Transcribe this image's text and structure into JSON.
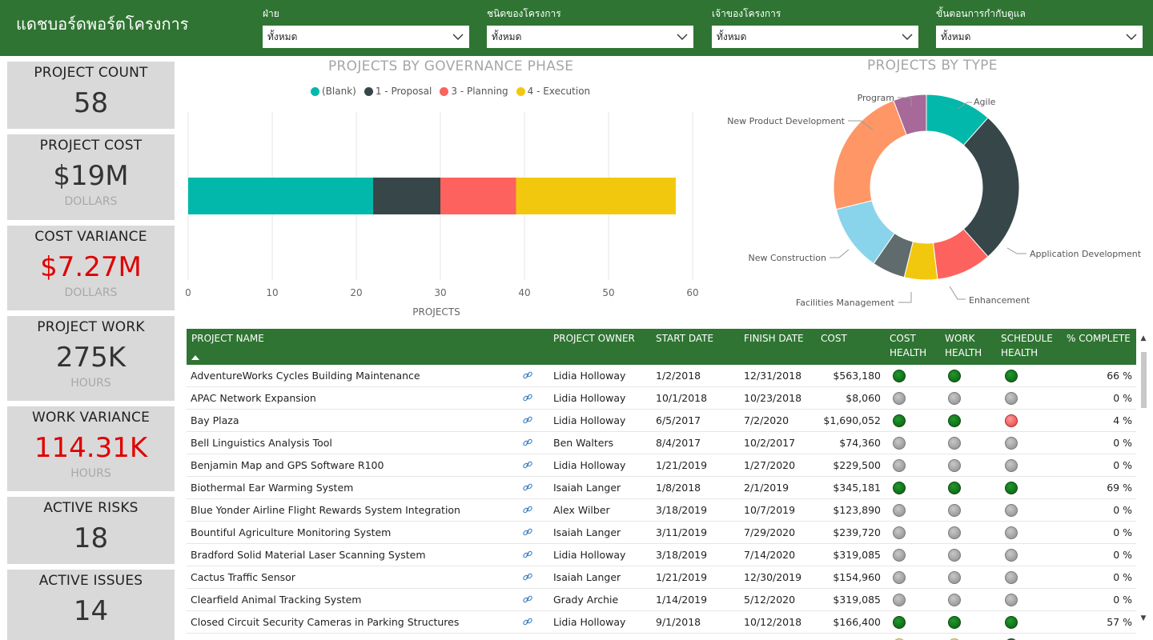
{
  "header": {
    "title": "แดชบอร์ดพอร์ตโครงการ",
    "filters": [
      {
        "label": "ฝ่าย",
        "value": "ทั้งหมด"
      },
      {
        "label": "ชนิดของโครงการ",
        "value": "ทั้งหมด"
      },
      {
        "label": "เจ้าของโครงการ",
        "value": "ทั้งหมด"
      },
      {
        "label": "ขั้นตอนการกำกับดูแล",
        "value": "ทั้งหมด"
      }
    ]
  },
  "cards": [
    {
      "title": "PROJECT COUNT",
      "value": "58",
      "unit": ""
    },
    {
      "title": "PROJECT COST",
      "value": "$19M",
      "unit": "DOLLARS"
    },
    {
      "title": "COST VARIANCE",
      "value": "$7.27M",
      "unit": "DOLLARS"
    },
    {
      "title": "PROJECT WORK",
      "value": "275K",
      "unit": "HOURS"
    },
    {
      "title": "WORK VARIANCE",
      "value": "114.31K",
      "unit": "HOURS"
    },
    {
      "title": "ACTIVE RISKS",
      "value": "18",
      "unit": ""
    },
    {
      "title": "ACTIVE ISSUES",
      "value": "14",
      "unit": ""
    }
  ],
  "colors": {
    "header_green": "#2f7432",
    "card_bg": "#d9d9d9",
    "variance_red": "#e00000",
    "teal": "#01b8aa",
    "dark": "#374649",
    "coral": "#fd625e",
    "yellow": "#f2c80f"
  },
  "chart_data": [
    {
      "type": "bar",
      "orientation": "horizontal",
      "stacked": true,
      "title": "PROJECTS BY GOVERNANCE PHASE",
      "xlabel": "PROJECTS",
      "xlim": [
        0,
        60
      ],
      "xticks": [
        0,
        10,
        20,
        30,
        40,
        50,
        60
      ],
      "legend_position": "top",
      "grid": true,
      "series": [
        {
          "name": "(Blank)",
          "color": "#01b8aa",
          "value": 22
        },
        {
          "name": "1 - Proposal",
          "color": "#374649",
          "value": 8
        },
        {
          "name": "3 - Planning",
          "color": "#fd625e",
          "value": 9
        },
        {
          "name": "4 - Execution",
          "color": "#f2c80f",
          "value": 19
        }
      ]
    },
    {
      "type": "pie",
      "variant": "donut",
      "title": "PROJECTS BY TYPE",
      "slices": [
        {
          "label": "Agile",
          "value": 6,
          "color": "#01b8aa"
        },
        {
          "label": "Application Development",
          "value": 14,
          "color": "#374649"
        },
        {
          "label": "Enhancement",
          "value": 5,
          "color": "#fd625e"
        },
        {
          "label": "Facilities Management",
          "value": 3,
          "color": "#f2c80f"
        },
        {
          "label": "New Construction",
          "value": 3,
          "color": "#5f6b6d"
        },
        {
          "label": "New Construction",
          "value": 6,
          "color": "#8ad4eb"
        },
        {
          "label": "New Product Development",
          "value": 12,
          "color": "#fe9666"
        },
        {
          "label": "Program",
          "value": 3,
          "color": "#a66999"
        }
      ]
    }
  ],
  "table": {
    "headers": {
      "name": "PROJECT NAME",
      "owner": "PROJECT OWNER",
      "start": "START DATE",
      "finish": "FINISH DATE",
      "cost": "COST",
      "cost_health_1": "COST",
      "cost_health_2": "HEALTH",
      "work_health_1": "WORK",
      "work_health_2": "HEALTH",
      "schedule_health_1": "SCHEDULE",
      "schedule_health_2": "HEALTH",
      "complete": "% COMPLETE"
    },
    "rows": [
      {
        "name": "AdventureWorks Cycles Building Maintenance",
        "owner": "Lidia Holloway",
        "start": "1/2/2018",
        "finish": "12/31/2018",
        "cost": "$563,180",
        "ch": "green",
        "wh": "green",
        "sh": "green",
        "complete": "66 %"
      },
      {
        "name": "APAC Network Expansion",
        "owner": "Lidia Holloway",
        "start": "10/1/2018",
        "finish": "10/23/2018",
        "cost": "$8,060",
        "ch": "gray",
        "wh": "gray",
        "sh": "gray",
        "complete": "0 %"
      },
      {
        "name": "Bay Plaza",
        "owner": "Lidia Holloway",
        "start": "6/5/2017",
        "finish": "7/2/2020",
        "cost": "$1,690,052",
        "ch": "green",
        "wh": "green",
        "sh": "red",
        "complete": "4 %"
      },
      {
        "name": "Bell Linguistics Analysis Tool",
        "owner": "Ben Walters",
        "start": "8/4/2017",
        "finish": "10/2/2017",
        "cost": "$74,360",
        "ch": "gray",
        "wh": "gray",
        "sh": "gray",
        "complete": "0 %"
      },
      {
        "name": "Benjamin Map and GPS Software R100",
        "owner": "Lidia Holloway",
        "start": "1/21/2019",
        "finish": "1/27/2020",
        "cost": "$229,500",
        "ch": "gray",
        "wh": "gray",
        "sh": "gray",
        "complete": "0 %"
      },
      {
        "name": "Biothermal Ear Warming System",
        "owner": "Isaiah Langer",
        "start": "1/8/2018",
        "finish": "2/1/2019",
        "cost": "$345,181",
        "ch": "green",
        "wh": "green",
        "sh": "green",
        "complete": "69 %"
      },
      {
        "name": "Blue Yonder Airline Flight Rewards System Integration",
        "owner": "Alex Wilber",
        "start": "3/18/2019",
        "finish": "10/7/2019",
        "cost": "$123,890",
        "ch": "gray",
        "wh": "gray",
        "sh": "gray",
        "complete": "0 %"
      },
      {
        "name": "Bountiful Agriculture Monitoring System",
        "owner": "Isaiah Langer",
        "start": "3/11/2019",
        "finish": "7/29/2020",
        "cost": "$239,720",
        "ch": "gray",
        "wh": "gray",
        "sh": "gray",
        "complete": "0 %"
      },
      {
        "name": "Bradford Solid Material Laser Scanning System",
        "owner": "Lidia Holloway",
        "start": "3/18/2019",
        "finish": "7/14/2020",
        "cost": "$319,085",
        "ch": "gray",
        "wh": "gray",
        "sh": "gray",
        "complete": "0 %"
      },
      {
        "name": "Cactus Traffic Sensor",
        "owner": "Isaiah Langer",
        "start": "1/21/2019",
        "finish": "12/30/2019",
        "cost": "$154,960",
        "ch": "gray",
        "wh": "gray",
        "sh": "gray",
        "complete": "0 %"
      },
      {
        "name": "Clearfield Animal Tracking System",
        "owner": "Grady Archie",
        "start": "1/14/2019",
        "finish": "5/12/2020",
        "cost": "$319,085",
        "ch": "gray",
        "wh": "gray",
        "sh": "gray",
        "complete": "0 %"
      },
      {
        "name": "Closed Circuit Security Cameras in Parking Structures",
        "owner": "Lidia Holloway",
        "start": "9/1/2018",
        "finish": "10/12/2018",
        "cost": "$166,400",
        "ch": "green",
        "wh": "green",
        "sh": "green",
        "complete": "57 %"
      },
      {
        "name": "",
        "owner": "",
        "start": "",
        "finish": "",
        "cost": "",
        "ch": "yellow",
        "wh": "yellow",
        "sh": "green",
        "complete": ""
      }
    ]
  }
}
